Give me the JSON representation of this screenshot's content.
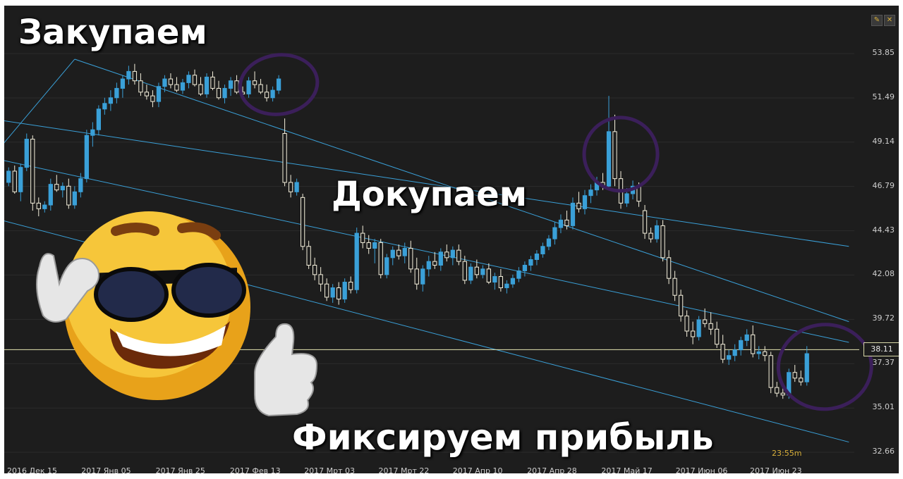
{
  "captions": {
    "buy": "Закупаем",
    "add": "Докупаем",
    "fix": "Фиксируем прибыль"
  },
  "current_price": "38.11",
  "timer": "23:55m",
  "controls": {
    "edit_icon": "pencil-icon",
    "close_icon": "close-icon",
    "edit_glyph": "✎",
    "close_glyph": "✕"
  },
  "colors": {
    "background": "#1d1d1d",
    "bull_candle": "#3aa0d8",
    "bear_candle": "#f5f0dc",
    "channel": "#3aa0d8",
    "price_line": "#e6e6b0",
    "circle": "#3b1f5a"
  },
  "chart_data": {
    "type": "candlestick",
    "y_ticks": [
      "53.85",
      "51.49",
      "49.14",
      "46.79",
      "44.43",
      "42.08",
      "39.72",
      "37.37",
      "35.01",
      "32.66"
    ],
    "x_ticks": [
      "2016 Дек 15",
      "2017 Янв 05",
      "2017 Янв 25",
      "2017 Фев 13",
      "2017 Мрт 03",
      "2017 Мрт 22",
      "2017 Апр 10",
      "2017 Апр 28",
      "2017 Май 17",
      "2017 Июн 06",
      "2017 Июн 23"
    ],
    "ylim": [
      32.66,
      53.85
    ],
    "current_price": 38.11,
    "grid": true,
    "candles": [
      [
        47.0,
        47.8,
        46.8,
        47.6
      ],
      [
        47.6,
        47.9,
        46.4,
        46.5
      ],
      [
        46.5,
        48.0,
        46.0,
        47.8
      ],
      [
        47.8,
        49.6,
        47.6,
        49.3
      ],
      [
        49.3,
        49.5,
        45.5,
        45.9
      ],
      [
        45.9,
        46.2,
        45.2,
        45.6
      ],
      [
        45.6,
        46.0,
        45.4,
        45.8
      ],
      [
        45.8,
        47.2,
        45.5,
        46.9
      ],
      [
        46.9,
        47.4,
        46.5,
        46.6
      ],
      [
        46.6,
        47.0,
        46.2,
        46.8
      ],
      [
        46.8,
        47.2,
        45.6,
        45.8
      ],
      [
        45.8,
        46.8,
        45.6,
        46.5
      ],
      [
        46.5,
        47.5,
        46.2,
        47.2
      ],
      [
        47.2,
        49.8,
        47.0,
        49.5
      ],
      [
        49.5,
        50.2,
        48.9,
        49.8
      ],
      [
        49.8,
        51.1,
        49.5,
        50.9
      ],
      [
        50.9,
        51.5,
        50.6,
        51.2
      ],
      [
        51.2,
        51.9,
        50.8,
        51.5
      ],
      [
        51.5,
        52.3,
        51.2,
        52.0
      ],
      [
        52.0,
        52.7,
        51.5,
        52.5
      ],
      [
        52.5,
        53.2,
        52.2,
        52.9
      ],
      [
        52.9,
        53.3,
        52.2,
        52.4
      ],
      [
        52.4,
        52.8,
        51.6,
        51.8
      ],
      [
        51.8,
        52.2,
        51.4,
        51.6
      ],
      [
        51.6,
        51.9,
        51.0,
        51.3
      ],
      [
        51.3,
        52.3,
        51.0,
        52.1
      ],
      [
        52.1,
        52.7,
        51.8,
        52.5
      ],
      [
        52.5,
        52.8,
        52.0,
        52.2
      ],
      [
        52.2,
        52.6,
        51.8,
        51.9
      ],
      [
        51.9,
        52.5,
        51.7,
        52.3
      ],
      [
        52.3,
        52.9,
        52.0,
        52.7
      ],
      [
        52.7,
        53.0,
        52.1,
        52.2
      ],
      [
        52.2,
        52.6,
        51.6,
        51.7
      ],
      [
        51.7,
        52.8,
        51.5,
        52.6
      ],
      [
        52.6,
        52.9,
        51.9,
        52.0
      ],
      [
        52.0,
        52.4,
        51.4,
        51.5
      ],
      [
        51.5,
        52.2,
        51.2,
        52.0
      ],
      [
        52.0,
        52.6,
        51.6,
        52.4
      ],
      [
        52.4,
        52.7,
        51.7,
        51.8
      ],
      [
        51.8,
        52.1,
        51.5,
        51.7
      ],
      [
        51.7,
        52.6,
        51.5,
        52.4
      ],
      [
        52.4,
        52.9,
        52.0,
        52.2
      ],
      [
        52.2,
        52.5,
        51.7,
        51.8
      ],
      [
        51.8,
        52.2,
        51.3,
        51.5
      ],
      [
        51.5,
        52.1,
        51.3,
        51.9
      ],
      [
        51.9,
        52.7,
        51.7,
        52.5
      ],
      [
        49.6,
        50.4,
        46.8,
        47.0
      ],
      [
        47.0,
        47.4,
        46.2,
        46.5
      ],
      [
        46.5,
        47.2,
        46.3,
        47.0
      ],
      [
        46.2,
        46.4,
        43.4,
        43.6
      ],
      [
        43.6,
        43.9,
        42.4,
        42.6
      ],
      [
        42.6,
        43.0,
        41.8,
        42.1
      ],
      [
        42.1,
        42.5,
        41.2,
        41.6
      ],
      [
        41.6,
        41.9,
        40.7,
        40.9
      ],
      [
        40.9,
        41.6,
        40.6,
        41.4
      ],
      [
        41.4,
        41.7,
        40.5,
        40.8
      ],
      [
        40.8,
        41.9,
        40.6,
        41.7
      ],
      [
        41.7,
        42.0,
        41.1,
        41.3
      ],
      [
        41.3,
        44.6,
        41.1,
        44.3
      ],
      [
        44.3,
        44.7,
        43.5,
        43.8
      ],
      [
        43.8,
        44.2,
        43.2,
        43.5
      ],
      [
        43.5,
        44.0,
        42.7,
        43.8
      ],
      [
        43.8,
        44.0,
        41.9,
        42.1
      ],
      [
        42.1,
        43.2,
        41.9,
        43.0
      ],
      [
        43.0,
        43.6,
        42.6,
        43.4
      ],
      [
        43.4,
        43.7,
        42.9,
        43.1
      ],
      [
        43.1,
        43.8,
        42.7,
        43.5
      ],
      [
        43.5,
        43.9,
        42.2,
        42.4
      ],
      [
        42.4,
        43.0,
        41.3,
        41.6
      ],
      [
        41.6,
        42.6,
        41.2,
        42.4
      ],
      [
        42.4,
        43.1,
        42.0,
        42.8
      ],
      [
        42.8,
        43.3,
        42.4,
        42.6
      ],
      [
        42.6,
        43.5,
        42.3,
        43.3
      ],
      [
        43.3,
        43.7,
        42.8,
        43.0
      ],
      [
        43.0,
        43.6,
        42.6,
        43.4
      ],
      [
        43.4,
        43.7,
        42.6,
        42.8
      ],
      [
        42.8,
        43.1,
        41.6,
        41.8
      ],
      [
        41.8,
        42.7,
        41.6,
        42.5
      ],
      [
        42.5,
        42.9,
        41.9,
        42.1
      ],
      [
        42.1,
        42.6,
        41.9,
        42.4
      ],
      [
        42.4,
        42.7,
        41.6,
        41.7
      ],
      [
        41.7,
        42.2,
        41.3,
        42.0
      ],
      [
        42.0,
        42.4,
        41.2,
        41.4
      ],
      [
        41.4,
        41.8,
        41.1,
        41.6
      ],
      [
        41.6,
        42.1,
        41.4,
        41.9
      ],
      [
        41.9,
        42.5,
        41.7,
        42.3
      ],
      [
        42.3,
        42.8,
        42.0,
        42.6
      ],
      [
        42.6,
        43.1,
        42.3,
        42.9
      ],
      [
        42.9,
        43.4,
        42.6,
        43.2
      ],
      [
        43.2,
        43.8,
        43.0,
        43.6
      ],
      [
        43.6,
        44.2,
        43.4,
        44.0
      ],
      [
        44.0,
        44.9,
        43.7,
        44.6
      ],
      [
        44.6,
        45.3,
        44.3,
        45.0
      ],
      [
        45.0,
        45.5,
        44.5,
        44.7
      ],
      [
        44.7,
        46.2,
        44.5,
        45.9
      ],
      [
        45.9,
        46.5,
        45.4,
        45.6
      ],
      [
        45.6,
        46.6,
        45.3,
        46.3
      ],
      [
        46.3,
        46.9,
        45.9,
        46.6
      ],
      [
        46.6,
        47.3,
        46.3,
        47.0
      ],
      [
        47.0,
        47.5,
        46.6,
        46.8
      ],
      [
        46.8,
        51.6,
        46.6,
        49.7
      ],
      [
        49.7,
        50.6,
        46.8,
        47.2
      ],
      [
        47.2,
        47.6,
        45.6,
        45.9
      ],
      [
        45.9,
        46.7,
        45.7,
        46.4
      ],
      [
        46.4,
        47.1,
        46.1,
        46.8
      ],
      [
        46.8,
        47.0,
        45.7,
        46.0
      ],
      [
        45.5,
        45.8,
        44.0,
        44.3
      ],
      [
        44.3,
        44.6,
        43.8,
        44.0
      ],
      [
        44.0,
        45.0,
        43.8,
        44.7
      ],
      [
        44.7,
        45.0,
        42.8,
        43.0
      ],
      [
        43.0,
        43.4,
        41.6,
        41.9
      ],
      [
        41.9,
        42.3,
        40.7,
        41.0
      ],
      [
        41.0,
        41.3,
        39.6,
        39.9
      ],
      [
        39.9,
        40.2,
        38.8,
        39.1
      ],
      [
        39.1,
        39.6,
        38.4,
        38.8
      ],
      [
        38.8,
        39.9,
        38.6,
        39.7
      ],
      [
        39.7,
        40.3,
        39.3,
        39.5
      ],
      [
        39.5,
        40.1,
        38.9,
        39.2
      ],
      [
        39.2,
        39.6,
        38.2,
        38.4
      ],
      [
        38.4,
        38.9,
        37.4,
        37.6
      ],
      [
        37.6,
        38.1,
        37.3,
        37.8
      ],
      [
        37.8,
        38.4,
        37.5,
        38.1
      ],
      [
        38.1,
        38.8,
        37.8,
        38.6
      ],
      [
        38.6,
        39.2,
        38.3,
        38.9
      ],
      [
        38.9,
        39.4,
        37.7,
        37.9
      ],
      [
        37.9,
        38.3,
        37.6,
        38.0
      ],
      [
        38.0,
        38.3,
        37.5,
        37.8
      ],
      [
        37.8,
        38.0,
        35.8,
        36.1
      ],
      [
        36.1,
        36.4,
        35.6,
        35.8
      ],
      [
        35.8,
        36.1,
        35.5,
        35.7
      ],
      [
        35.7,
        37.1,
        35.5,
        36.9
      ],
      [
        36.9,
        37.3,
        36.4,
        36.6
      ],
      [
        36.6,
        37.0,
        36.2,
        36.4
      ],
      [
        36.4,
        38.3,
        36.2,
        37.9
      ]
    ]
  }
}
